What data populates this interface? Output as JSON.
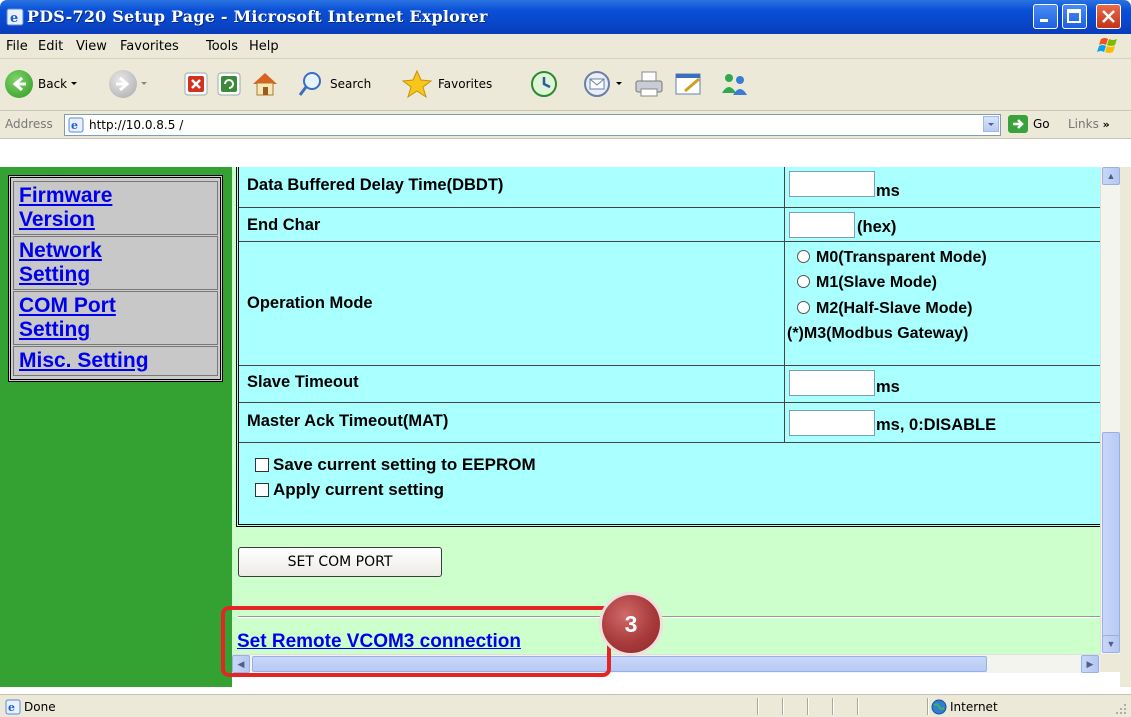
{
  "window": {
    "title": "PDS-720 Setup Page - Microsoft Internet Explorer"
  },
  "menu": [
    "File",
    "Edit",
    "View",
    "Favorites",
    "Tools",
    "Help"
  ],
  "toolbar": {
    "back_label": "Back",
    "search_label": "Search",
    "favorites_label": "Favorites"
  },
  "address": {
    "label": "Address",
    "url": "http://10.0.8.5  /",
    "go_label": "Go",
    "links_label": "Links"
  },
  "nav": {
    "items": [
      {
        "line1": "Firmware",
        "line2": "Version"
      },
      {
        "line1": "Network",
        "line2": "Setting"
      },
      {
        "line1": "COM Port",
        "line2": "Setting"
      },
      {
        "line1": "Misc. Setting"
      }
    ]
  },
  "form": {
    "dbdt_label": "Data Buffered Delay Time(DBDT)",
    "dbdt_value": "",
    "dbdt_unit": "ms",
    "endchar_label": "End Char",
    "endchar_value": "",
    "endchar_unit": "(hex)",
    "opmode_label": "Operation Mode",
    "opmode_options": [
      "M0(Transparent Mode)",
      "M1(Slave Mode)",
      "M2(Half-Slave Mode)",
      "(*)M3(Modbus Gateway)"
    ],
    "slave_timeout_label": "Slave Timeout",
    "slave_timeout_value": "",
    "slave_timeout_unit": "ms",
    "mat_label": "Master Ack Timeout(MAT)",
    "mat_value": "",
    "mat_unit": "ms, 0:DISABLE",
    "save_eeprom_label": "Save current setting to EEPROM",
    "apply_label": "Apply current setting",
    "set_button": "SET COM PORT",
    "remote_link": "Set Remote VCOM3 connection"
  },
  "annotation": {
    "badge": "3",
    "color": "#e32526"
  },
  "status": {
    "text": "Done",
    "zone": "Internet"
  }
}
